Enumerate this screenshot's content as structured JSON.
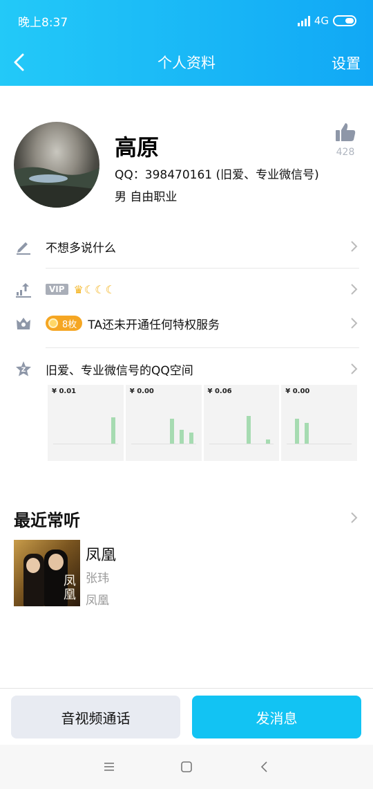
{
  "status_bar": {
    "time": "晚上8:37",
    "network": "4G"
  },
  "header": {
    "title": "个人资料",
    "settings_label": "设置"
  },
  "profile": {
    "name": "高原",
    "qq_line": "QQ：398470161 (旧爱、专业微信号)",
    "gender_job": "男  自由职业",
    "like_count": "428"
  },
  "rows": {
    "signature": "不想多说什么",
    "vip_badge": "VIP",
    "vip_icons": "♛☾☾☾",
    "coins_badge": "8枚",
    "privilege": "TA还未开通任何特权服务",
    "qzone": "旧爱、专业微信号的QQ空间"
  },
  "qzone_thumbs": [
    {
      "amount": "¥ 0.01"
    },
    {
      "amount": "¥ 0.00"
    },
    {
      "amount": "¥ 0.06"
    },
    {
      "amount": "¥ 0.00"
    }
  ],
  "recent": {
    "section_title": "最近常听",
    "song_title": "凤凰",
    "artist": "张玮",
    "album": "凤凰",
    "cover_text": "凤凰"
  },
  "actions": {
    "call_label": "音视频通话",
    "message_label": "发消息"
  },
  "colors": {
    "header_start": "#23c9f8",
    "header_end": "#11a8f5",
    "primary_button": "#12c3f3",
    "secondary_button": "#e8ebf2"
  }
}
